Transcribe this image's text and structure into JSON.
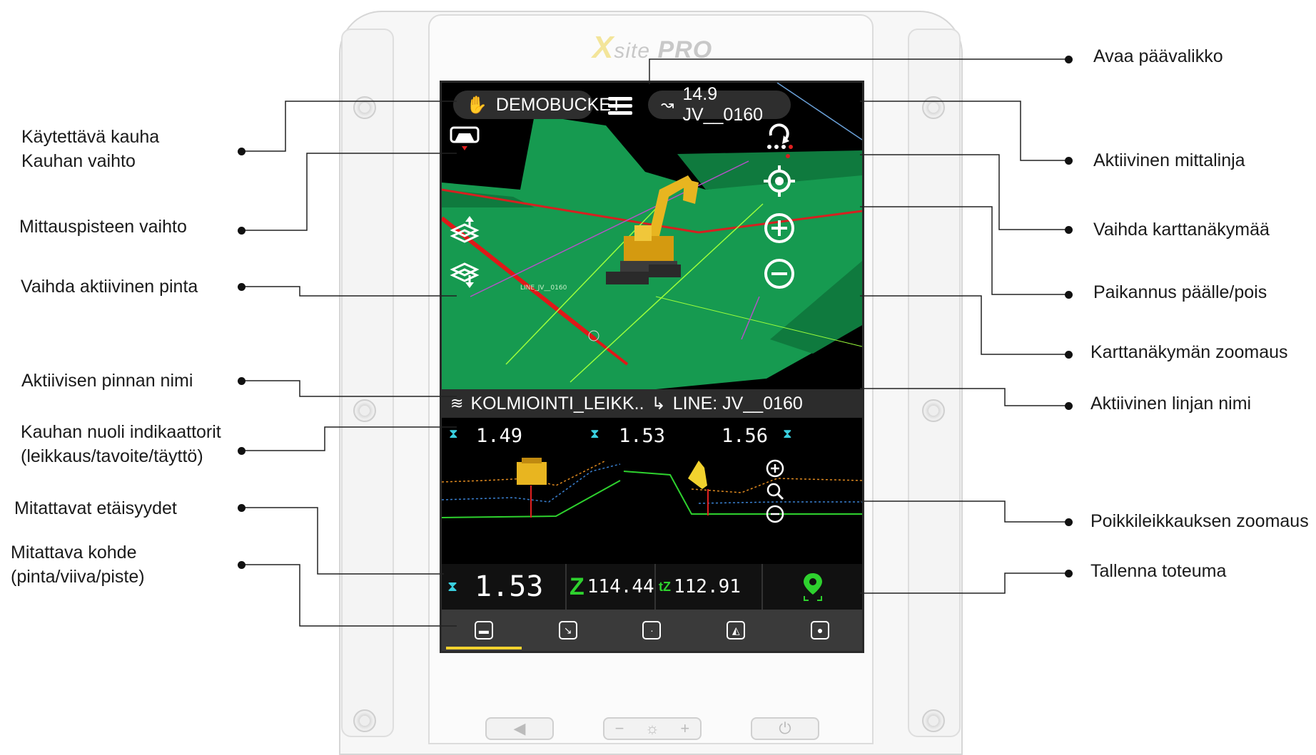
{
  "brand": {
    "x": "X",
    "site": "site",
    "pro": "PRO"
  },
  "screen": {
    "bucket_name": "DEMOBUCKET",
    "line_info": "14.9 JV__0160",
    "map_line_label": "LINE_JV__0160",
    "surface_name": "KOLMIOINTI_LEIKK..",
    "line_name": "LINE: JV__0160",
    "indicators": [
      "1.49",
      "1.53",
      "1.56"
    ],
    "measure_value": "1.53",
    "z_value": "114.44",
    "tz_value": "112.91",
    "z_label": "Z",
    "tz_label": "tZ"
  },
  "tabs": [
    {
      "name": "surface",
      "active": true
    },
    {
      "name": "line",
      "active": false
    },
    {
      "name": "point",
      "active": false
    },
    {
      "name": "bucket-surface",
      "active": false
    },
    {
      "name": "location",
      "active": false
    }
  ],
  "hardware": {
    "vol_minus": "−",
    "brightness": "☼",
    "vol_plus": "+"
  },
  "annotations": {
    "left": [
      "Käytettävä kauha",
      "Kauhan vaihto",
      "Mittauspisteen vaihto",
      "Vaihda aktiivinen pinta",
      "Aktiivisen pinnan nimi",
      "Kauhan nuoli indikaattorit",
      "(leikkaus/tavoite/täyttö)",
      "Mitattavat etäisyydet",
      "Mitattava kohde",
      "(pinta/viiva/piste)"
    ],
    "right": [
      "Avaa päävalikko",
      "Aktiivinen mittalinja",
      "Vaihda karttanäkymää",
      "Paikannus päälle/pois",
      "Karttanäkymän zoomaus",
      "Aktiivinen linjan nimi",
      "Poikkileikkauksen zoomaus",
      "Tallenna toteuma"
    ]
  },
  "colors": {
    "terrain": "#139b4f",
    "accent": "#f2d22e",
    "green_icon": "#2ed12e",
    "cyan": "#3ad0e0"
  }
}
